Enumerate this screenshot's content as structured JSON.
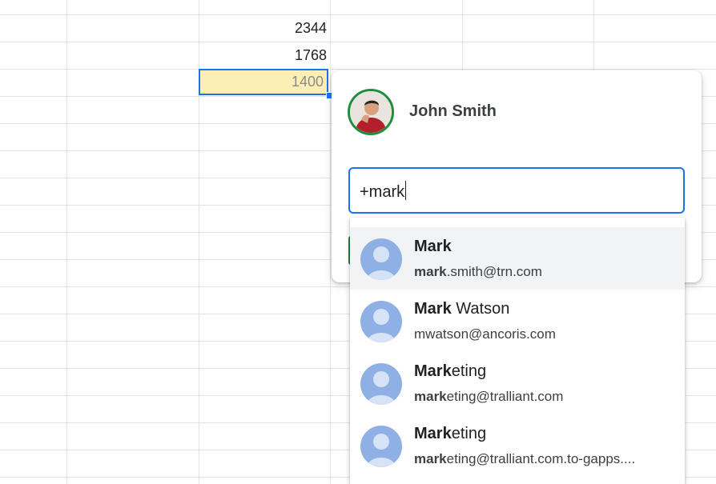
{
  "sheet": {
    "cells": [
      {
        "value": "2344"
      },
      {
        "value": "1768"
      }
    ],
    "selected_cell": {
      "value": "1400"
    }
  },
  "comment": {
    "user_name": "John Smith",
    "input_value": "+mark"
  },
  "suggestions": [
    {
      "name_match": "Mark",
      "name_rest": "",
      "email_match": "mark",
      "email_rest": ".smith@trn.com"
    },
    {
      "name_match": "Mark",
      "name_rest": " Watson",
      "email_match": "",
      "email_rest": "mwatson@ancoris.com"
    },
    {
      "name_match": "Mark",
      "name_rest": "eting",
      "email_match": "mark",
      "email_rest": "eting@tralliant.com"
    },
    {
      "name_match": "Mark",
      "name_rest": "eting",
      "email_match": "mark",
      "email_rest": "eting@tralliant.com.to-gapps...."
    }
  ],
  "colors": {
    "selection_border": "#1a73e8",
    "selection_fill": "#fdeeb5",
    "avatar_ring": "#1e8e3e",
    "placeholder_avatar": "#8eb0e4"
  },
  "icons": {
    "user_avatar": "profile-photo",
    "suggestion_avatar": "person-placeholder-icon"
  }
}
